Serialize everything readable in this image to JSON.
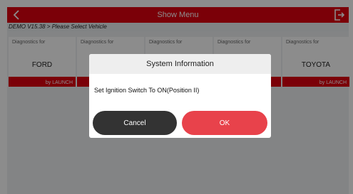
{
  "topbar": {
    "title": "Show Menu"
  },
  "breadcrumb": "DEMO V15.38 > Please Select Vehicle",
  "cards": [
    {
      "caption": "Diagnostics for",
      "make": "FORD",
      "brand": "by LAUNCH"
    },
    {
      "caption": "Diagnostics for",
      "make": "",
      "brand": ""
    },
    {
      "caption": "Diagnostics for",
      "make": "",
      "brand": ""
    },
    {
      "caption": "Diagnostics for",
      "make": "",
      "brand": ""
    },
    {
      "caption": "Diagnostics for",
      "make": "TOYOTA",
      "brand": "by LAUNCH"
    }
  ],
  "dialog": {
    "title": "System Information",
    "message": "Set Ignition Switch To ON(Position II)",
    "cancel_label": "Cancel",
    "ok_label": "OK"
  },
  "colors": {
    "accent": "#e1000f",
    "ok_button": "#e8424b",
    "cancel_button": "#333333"
  },
  "icons": {
    "back": "chevron-left-icon",
    "exit": "exit-icon"
  }
}
